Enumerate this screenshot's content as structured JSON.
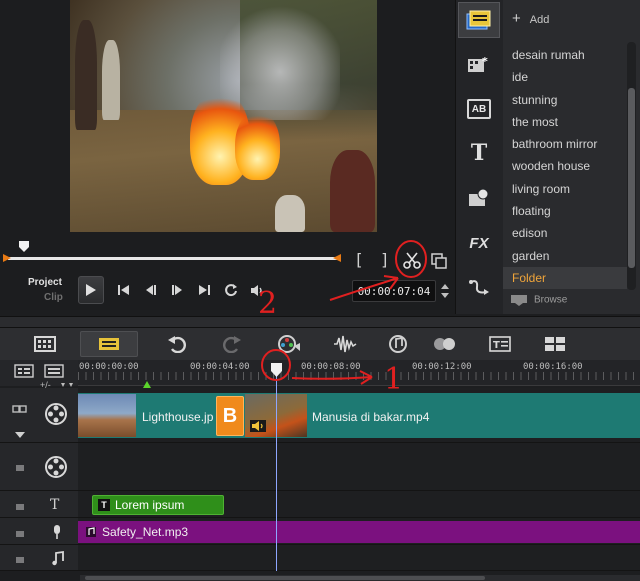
{
  "player": {
    "project_label": "Project",
    "clip_label": "Clip",
    "timecode": "00:00:07:04",
    "in_bracket": "[",
    "out_bracket": "]"
  },
  "library": {
    "add_label": "Add",
    "items": [
      {
        "label": "desain rumah"
      },
      {
        "label": "ide"
      },
      {
        "label": "stunning"
      },
      {
        "label": "the most"
      },
      {
        "label": "bathroom mirror"
      },
      {
        "label": "wooden house"
      },
      {
        "label": "living room"
      },
      {
        "label": "floating"
      },
      {
        "label": "edison"
      },
      {
        "label": "garden"
      },
      {
        "label": "Folder"
      }
    ],
    "selected_index": 10,
    "browse_label": "Browse",
    "side_icons": [
      "media-icon",
      "instant-project-icon",
      "transition-icon",
      "title-icon",
      "graphic-icon",
      "fx-icon",
      "path-icon"
    ],
    "fx_label": "FX",
    "ab_label": "AB",
    "title_glyph": "T"
  },
  "ruler": {
    "labels": [
      "00:00:00:00",
      "00:00:04:00",
      "00:00:08:00",
      "00:00:12:00",
      "00:00:16:00"
    ]
  },
  "timeline": {
    "video_clip_1": "Lighthouse.jp",
    "transition_letter": "B",
    "video_clip_2": "Manusia di bakar.mp4",
    "title_clip": "Lorem ipsum",
    "audio_clip": "Safety_Net.mp3",
    "title_track_icon": "T",
    "zoom_label": "+/-"
  },
  "annotations": {
    "label_1": "1",
    "label_2": "2"
  },
  "colors": {
    "video_clip": "#1e7a73",
    "transition": "#f08a1c",
    "title_clip": "#2f8f1a",
    "audio_clip": "#7b117f",
    "annotation": "#e02020",
    "selected_item": "#f0a53a"
  }
}
